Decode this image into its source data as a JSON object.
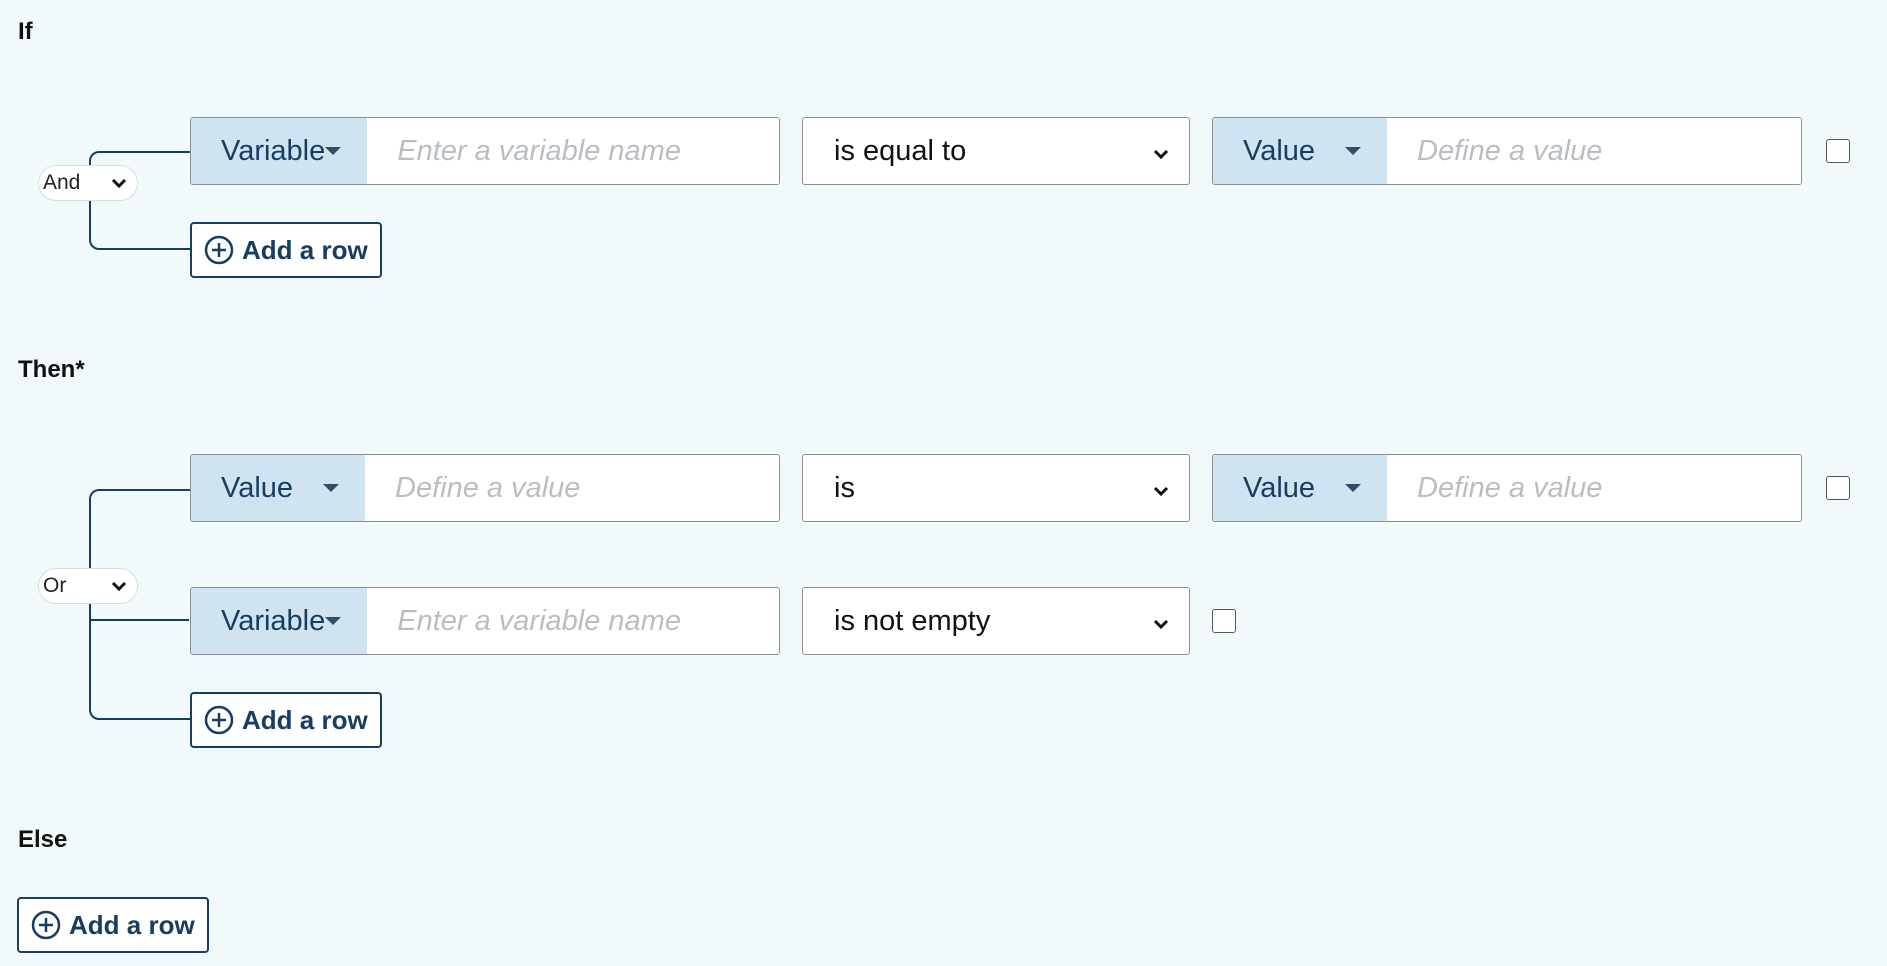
{
  "sections": {
    "if": {
      "title": "If",
      "logic": "And",
      "rows": [
        {
          "type": "Variable",
          "placeholder": "Enter a variable name",
          "operator": "is equal to",
          "right_type": "Value",
          "right_placeholder": "Define a value",
          "checked": false
        }
      ],
      "add_row_label": "Add a row"
    },
    "then": {
      "title": "Then*",
      "logic": "Or",
      "rows": [
        {
          "type": "Value",
          "placeholder": "Define a value",
          "operator": "is",
          "right_type": "Value",
          "right_placeholder": "Define a value",
          "checked": false
        },
        {
          "type": "Variable",
          "placeholder": "Enter a variable name",
          "operator": "is not empty",
          "checked": false
        }
      ],
      "add_row_label": "Add a row"
    },
    "else": {
      "title": "Else",
      "add_row_label": "Add a row"
    }
  },
  "icons": {
    "dropdown": "caret-down-icon",
    "select": "chevron-down-icon",
    "add": "plus-circle-icon"
  },
  "colors": {
    "primary": "#173d62",
    "type_bg": "#cfe3f1",
    "page_bg": "#f2f9fb"
  }
}
